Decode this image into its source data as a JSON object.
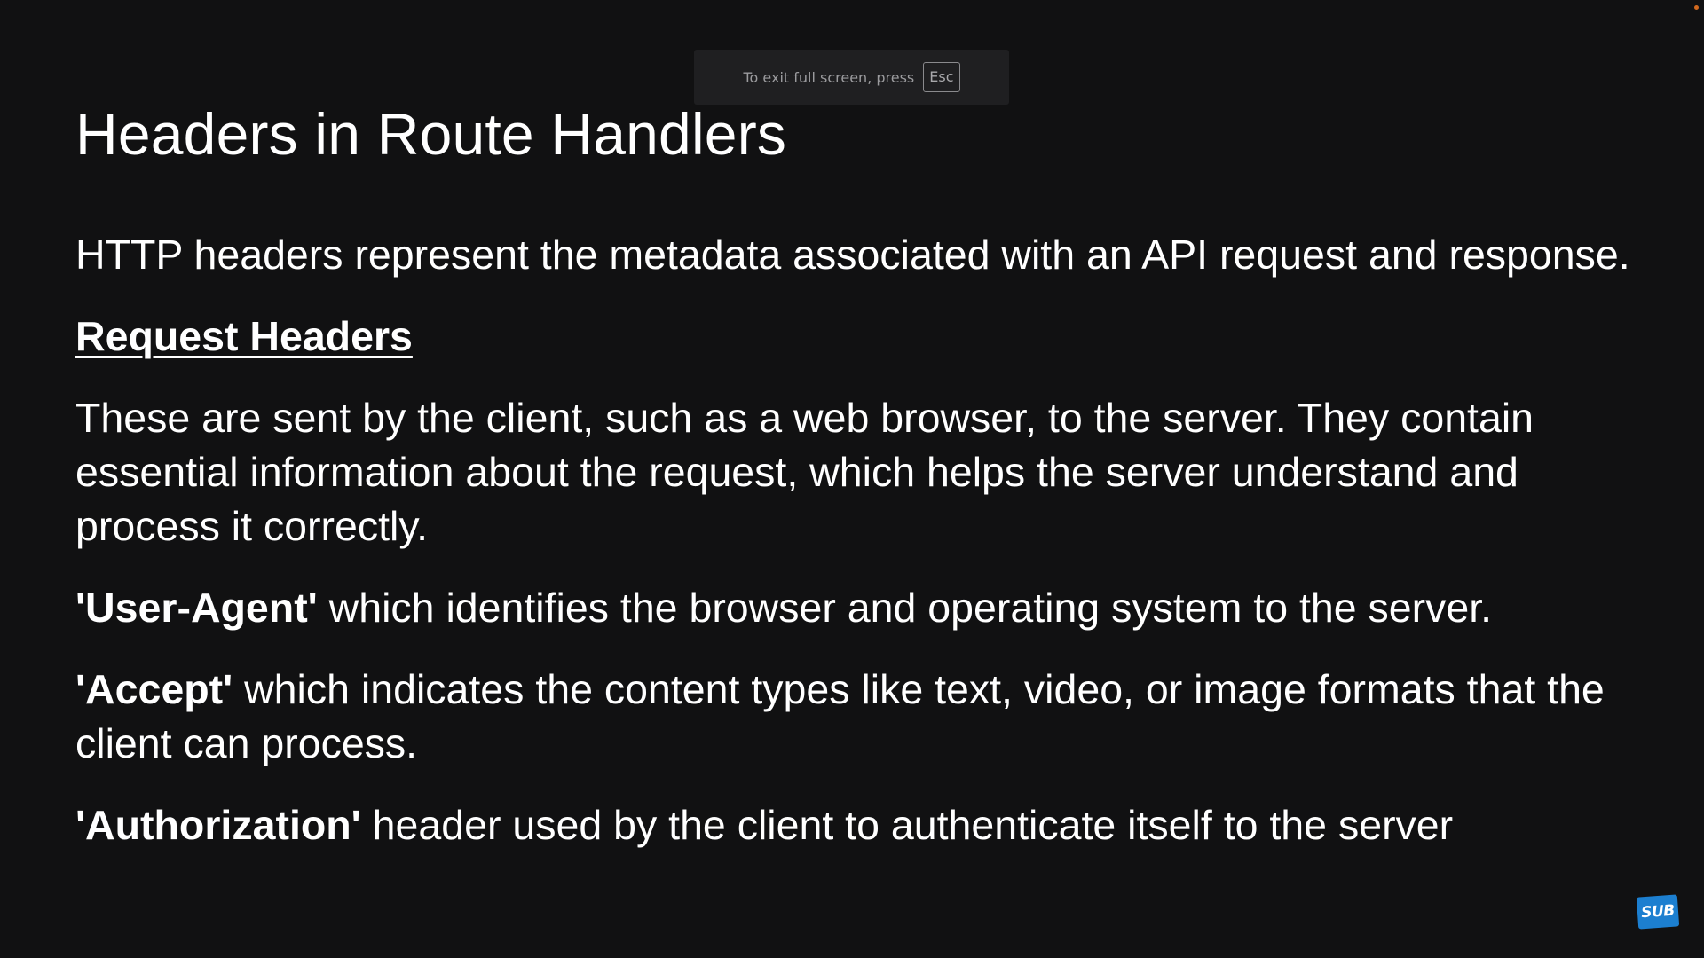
{
  "fullscreen_notice": {
    "text": "To exit full screen, press",
    "key_label": "Esc"
  },
  "slide": {
    "title": "Headers in Route Handlers",
    "intro": "HTTP headers represent the metadata associated with an API request and response.",
    "section_heading": "Request Headers",
    "section_description": "These are sent by the client, such as a web browser, to the server. They contain essential information about the request, which helps the server understand and process it correctly.",
    "headers": [
      {
        "name": "'User-Agent'",
        "description": " which identifies the browser and operating system to the server."
      },
      {
        "name": "'Accept'",
        "description": " which indicates the content types like text, video, or image formats that the client can process."
      },
      {
        "name": "'Authorization'",
        "description": " header used by the client to authenticate itself to the server"
      }
    ]
  },
  "badge": {
    "label": "SUB",
    "color": "#1c7fd0"
  }
}
